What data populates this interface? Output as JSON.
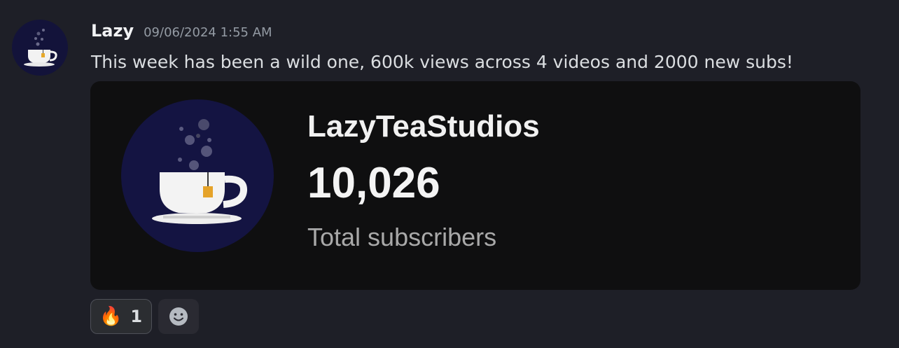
{
  "message": {
    "username": "Lazy",
    "timestamp": "09/06/2024 1:55 AM",
    "content": "This week has been a wild one, 600k views across 4 videos and 2000 new subs!"
  },
  "embed_image": {
    "channel_name": "LazyTeaStudios",
    "subscriber_count": "10,026",
    "subscriber_label": "Total subscribers",
    "avatar_icon": "tea-cup-icon"
  },
  "reactions": [
    {
      "emoji": "🔥",
      "icon": "fire-icon",
      "count": "1"
    }
  ],
  "add_reaction_icon": "smiley-face-icon",
  "colors": {
    "background": "#1e1f27",
    "card_background": "#0f0f10",
    "avatar_background": "#141442",
    "username": "#f2f3f5",
    "timestamp": "#949ba4"
  }
}
